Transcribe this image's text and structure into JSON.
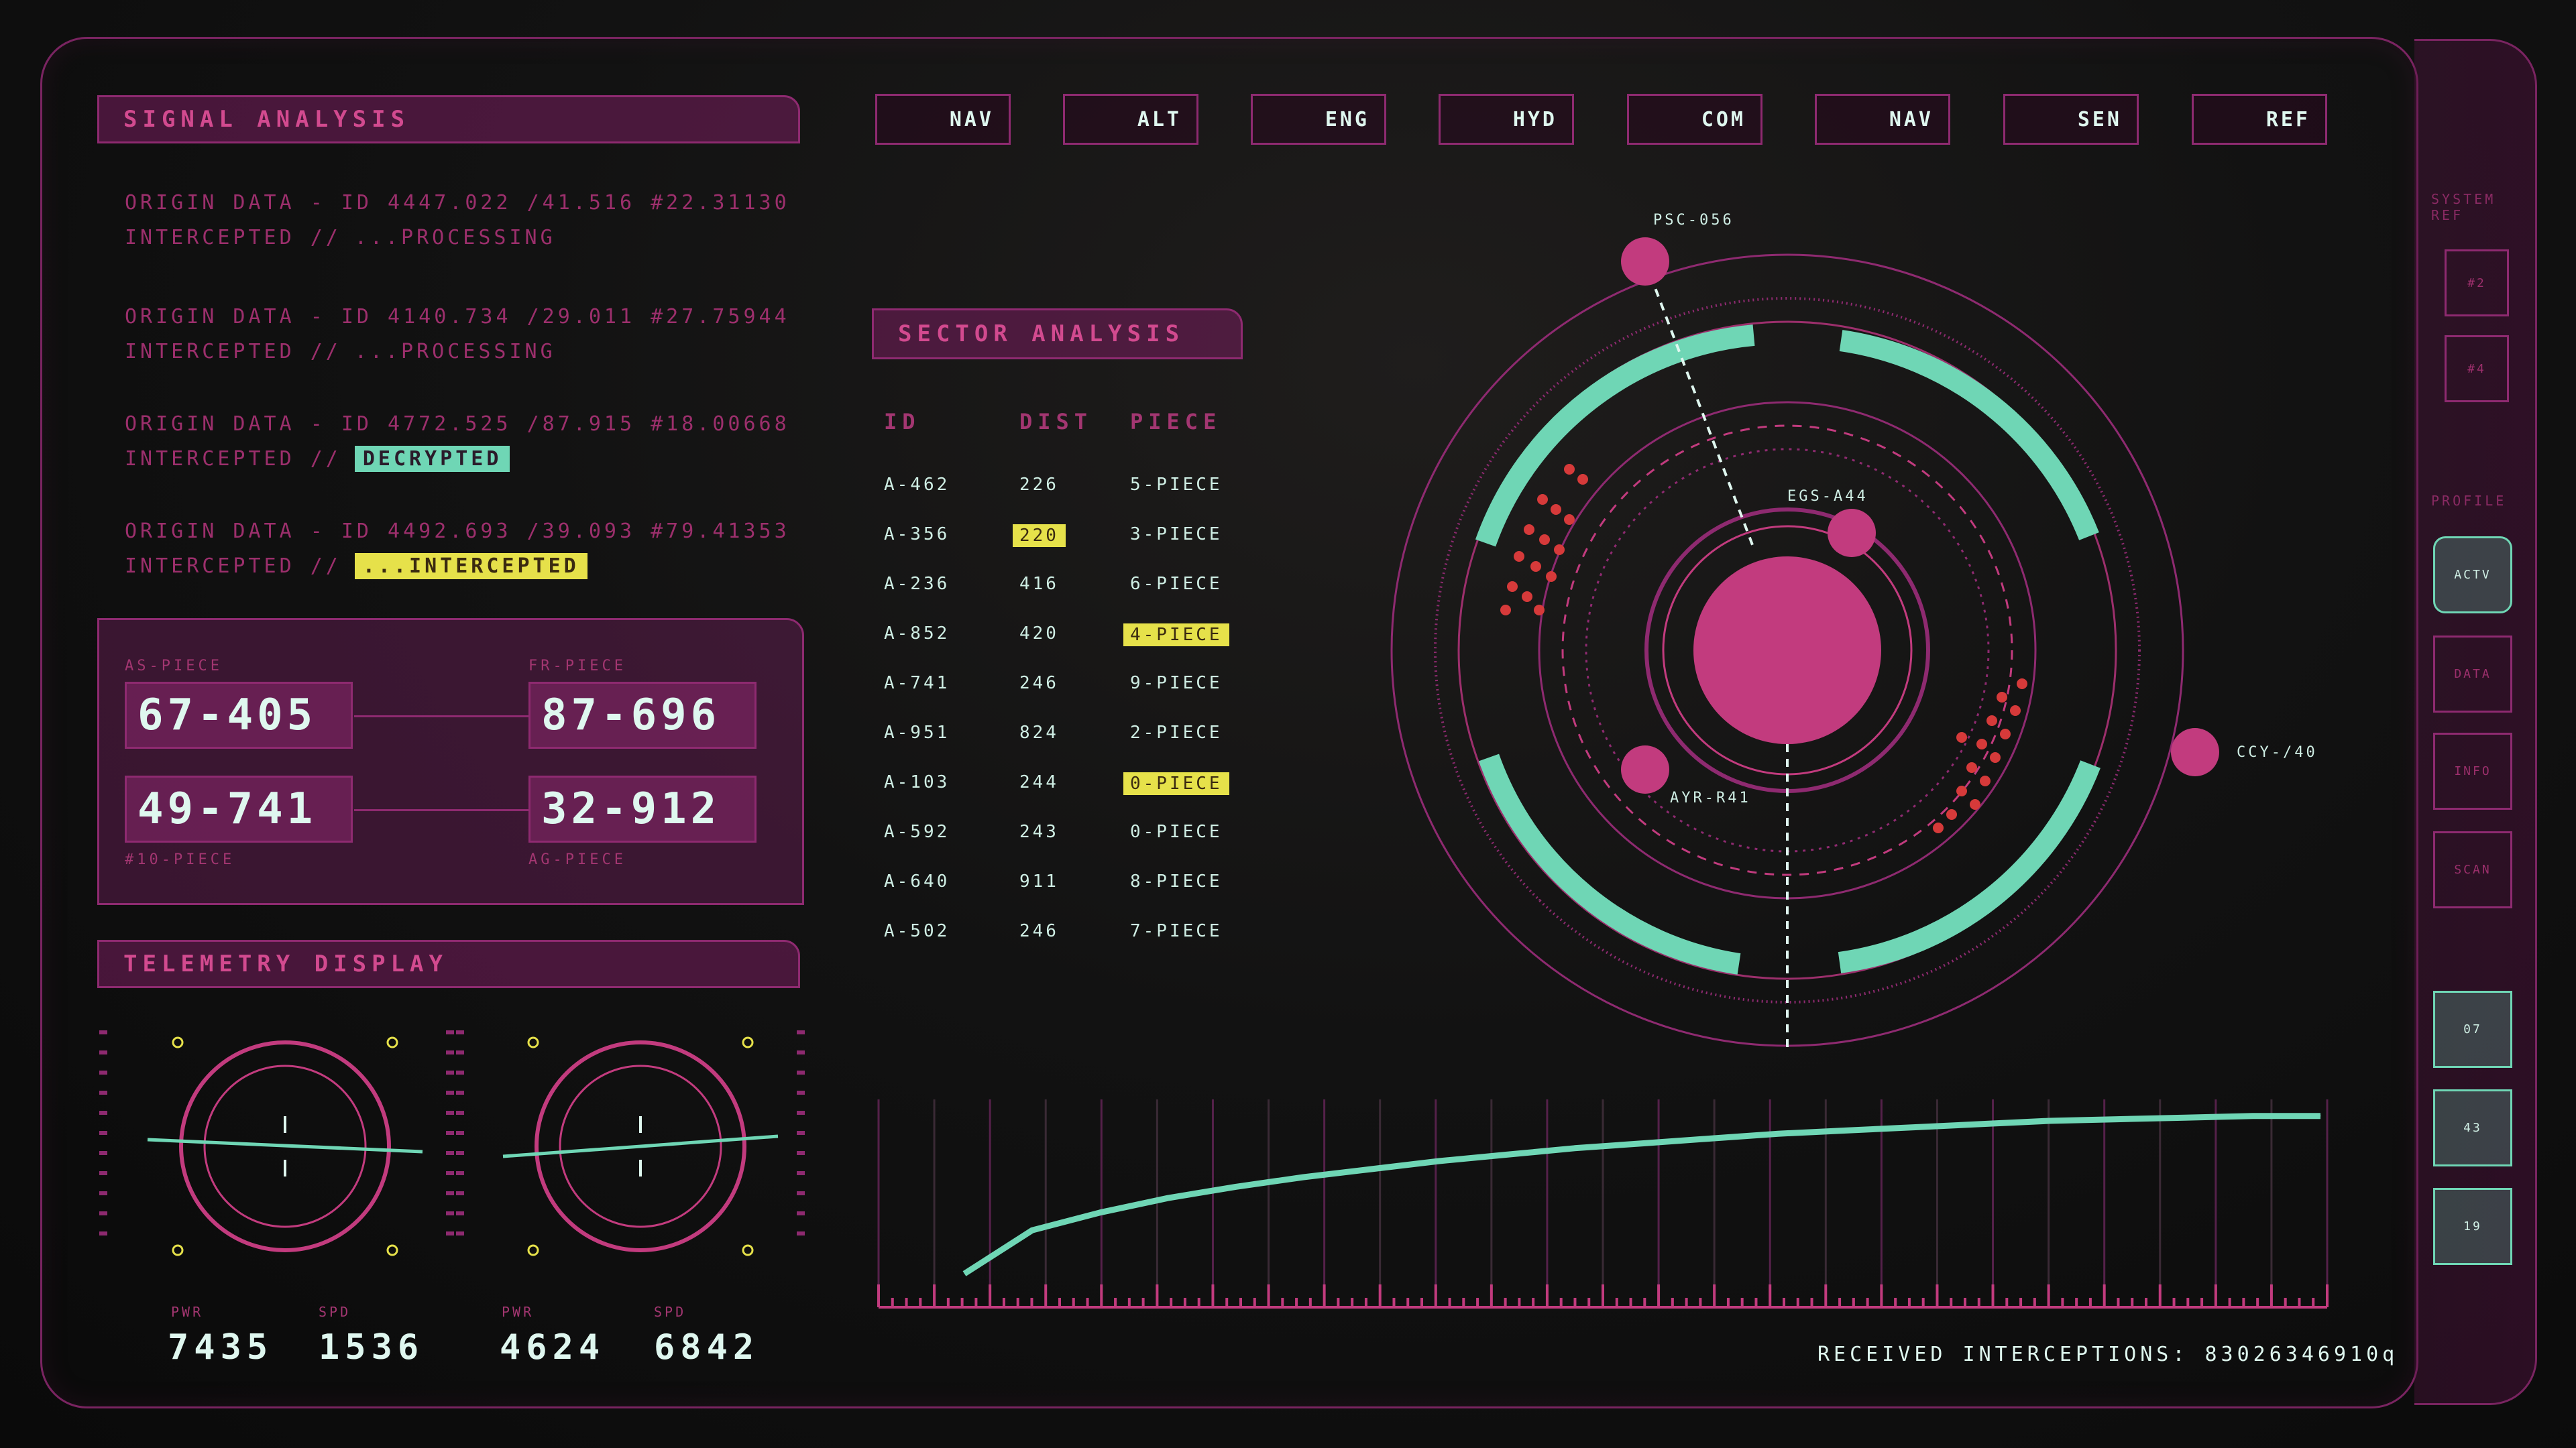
{
  "colors": {
    "magenta": "#c23b7e",
    "magenta_dark": "#7a2461",
    "mint": "#6fd6b5",
    "yellow": "#e6e14a",
    "text_light": "#dff7ef"
  },
  "signal_panel": {
    "title": "SIGNAL ANALYSIS",
    "entries": [
      {
        "line": "ORIGIN DATA - ID 4447.022 /41.516 #22.31130",
        "sub_label": "INTERCEPTED //",
        "sub_value": "...PROCESSING",
        "tag": "none"
      },
      {
        "line": "ORIGIN DATA - ID 4140.734 /29.011 #27.75944",
        "sub_label": "INTERCEPTED //",
        "sub_value": "...PROCESSING",
        "tag": "none"
      },
      {
        "line": "ORIGIN DATA - ID 4772.525 /87.915 #18.00668",
        "sub_label": "INTERCEPTED //",
        "sub_value": "DECRYPTED",
        "tag": "mint"
      },
      {
        "line": "ORIGIN DATA - ID 4492.693 /39.093 #79.41353",
        "sub_label": "INTERCEPTED //",
        "sub_value": "...INTERCEPTED",
        "tag": "yellow"
      }
    ]
  },
  "code_panel": {
    "labels": [
      "AS-PIECE",
      "FR-PIECE",
      "#10-PIECE",
      "AG-PIECE"
    ],
    "codes": [
      "67-405",
      "87-696",
      "49-741",
      "32-912"
    ]
  },
  "telemetry": {
    "title": "TELEMETRY DISPLAY",
    "gauges": [
      {
        "label_a": "PWR",
        "value_a": "7435",
        "label_b": "SPD",
        "value_b": "1536"
      },
      {
        "label_a": "PWR",
        "value_a": "4624",
        "label_b": "SPD",
        "value_b": "6842"
      }
    ]
  },
  "top_tabs": [
    "NAV",
    "ALT",
    "ENG",
    "HYD",
    "COM",
    "NAV",
    "SEN",
    "REF"
  ],
  "sector_panel": {
    "title": "SECTOR ANALYSIS",
    "headers": [
      "ID",
      "DIST",
      "PIECE"
    ],
    "rows": [
      {
        "id": "A-462",
        "dist": "226",
        "piece": "5-PIECE",
        "hl": "none"
      },
      {
        "id": "A-356",
        "dist": "220",
        "piece": "3-PIECE",
        "hl": "dist"
      },
      {
        "id": "A-236",
        "dist": "416",
        "piece": "6-PIECE",
        "hl": "none"
      },
      {
        "id": "A-852",
        "dist": "420",
        "piece": "4-PIECE",
        "hl": "piece"
      },
      {
        "id": "A-741",
        "dist": "246",
        "piece": "9-PIECE",
        "hl": "none"
      },
      {
        "id": "A-951",
        "dist": "824",
        "piece": "2-PIECE",
        "hl": "none"
      },
      {
        "id": "A-103",
        "dist": "244",
        "piece": "0-PIECE",
        "hl": "piece"
      },
      {
        "id": "A-592",
        "dist": "243",
        "piece": "0-PIECE",
        "hl": "none"
      },
      {
        "id": "A-640",
        "dist": "911",
        "piece": "8-PIECE",
        "hl": "none"
      },
      {
        "id": "A-502",
        "dist": "246",
        "piece": "7-PIECE",
        "hl": "none"
      }
    ]
  },
  "orbital": {
    "labels": [
      "PSC-056",
      "EGS-A44",
      "AYR-R41",
      "CCY-/40"
    ]
  },
  "right_rail": {
    "top_label": "SYSTEM REF",
    "small_buttons": [
      "#2",
      "#4"
    ],
    "mid_label": "PROFILE",
    "mode_buttons": [
      "ACTV",
      "DATA",
      "INFO",
      "SCAN"
    ],
    "bottom_buttons": [
      "07",
      "43",
      "19"
    ]
  },
  "chart_data": {
    "type": "line",
    "title": "",
    "xlabel": "",
    "ylabel": "",
    "x": [
      0,
      1,
      2,
      3,
      4,
      5,
      6,
      7,
      8,
      9,
      10,
      11,
      12,
      13,
      14,
      15,
      16,
      17,
      18,
      19,
      20
    ],
    "series": [
      {
        "values": [
          0.0,
          0.27,
          0.38,
          0.47,
          0.54,
          0.6,
          0.65,
          0.7,
          0.74,
          0.78,
          0.81,
          0.84,
          0.87,
          0.89,
          0.91,
          0.93,
          0.95,
          0.96,
          0.97,
          0.98,
          0.98
        ]
      }
    ],
    "ylim": [
      0,
      1
    ],
    "grid": true
  },
  "footer": {
    "text": "RECEIVED INTERCEPTIONS: 83026346910q"
  }
}
